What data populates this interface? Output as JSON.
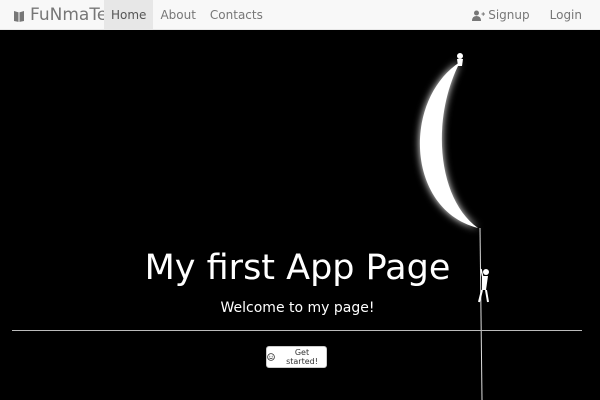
{
  "navbar": {
    "brand": "FuNmaTe",
    "brand_icon": "book-icon",
    "left_items": [
      {
        "label": "Home",
        "active": true
      },
      {
        "label": "About",
        "active": false
      },
      {
        "label": "Contacts",
        "active": false
      }
    ],
    "right_items": [
      {
        "label": "Signup",
        "icon": "user-plus-icon"
      },
      {
        "label": "Login"
      }
    ]
  },
  "hero": {
    "title": "My first App Page",
    "subtitle": "Welcome to my page!",
    "cta_label": "Get started!",
    "cta_icon": "smile-icon",
    "background_color": "#000000"
  },
  "colors": {
    "navbar_bg": "#f8f8f8",
    "nav_text": "#777777",
    "nav_active_bg": "#e7e7e7"
  }
}
